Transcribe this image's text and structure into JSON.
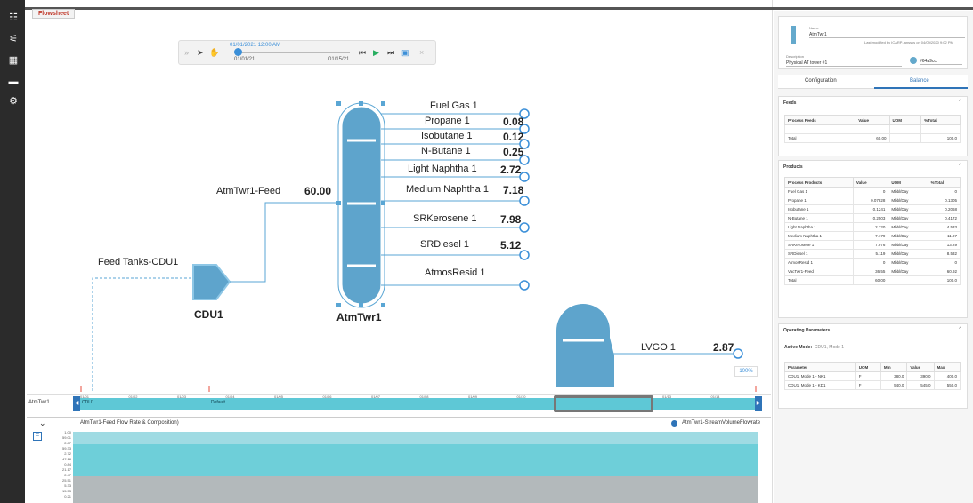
{
  "tab": "Flowsheet",
  "player": {
    "current_datetime": "01/01/2021 12:00 AM",
    "start_date": "01/01/21",
    "end_date": "01/15/21",
    "position": 0.0
  },
  "flowsheet": {
    "feed_source": "Feed Tanks-CDU1",
    "cdu_name": "CDU1",
    "tower_name": "AtmTwr1",
    "feed_stream": "AtmTwr1-Feed",
    "feed_value": "60.00",
    "products": [
      {
        "name": "Fuel Gas 1",
        "value": ""
      },
      {
        "name": "Propane 1",
        "value": "0.08"
      },
      {
        "name": "Isobutane 1",
        "value": "0.12"
      },
      {
        "name": "N-Butane 1",
        "value": "0.25"
      },
      {
        "name": "Light Naphtha 1",
        "value": "2.72"
      },
      {
        "name": "Medium Naphtha 1",
        "value": "7.18"
      },
      {
        "name": "SRKerosene 1",
        "value": "7.98"
      },
      {
        "name": "SRDiesel 1",
        "value": "5.12"
      },
      {
        "name": "AtmosResid 1",
        "value": ""
      }
    ],
    "vac_stream": "LVGO 1",
    "vac_value": "2.87",
    "zoom": "100%"
  },
  "timeline": {
    "row_label": "AtmTwr1",
    "segment_unit": "CDU1",
    "segment_mode": "Default",
    "ticks": [
      "01/01",
      "01/02",
      "01/03",
      "01/04",
      "01/05",
      "01/06",
      "01/07",
      "01/08",
      "01/09",
      "01/10",
      "01/11",
      "01/12",
      "01/13",
      "01/14"
    ]
  },
  "trend": {
    "title": "AtmTwr1-Feed Flow Rate & Composition)",
    "legend": "AtmTwr1-StreamVolumeFlowrate",
    "axis_ticks": [
      "1.00",
      "59.01",
      "2.87",
      "59.33",
      "2.72",
      "47.18",
      "0.84",
      "21.17",
      "2.47",
      "25.51",
      "5.33",
      "15.53",
      "0.21"
    ]
  },
  "panel": {
    "name_label": "Name",
    "name": "AtmTwr1",
    "modified": "Last modified by ICARP-janssys on 04/09/2020 9:02 PM",
    "desc_label": "Description",
    "description": "Physical AT tower #1",
    "color_hex": "#64a9cc",
    "tab_config": "Configuration",
    "tab_balance": "Balance",
    "feeds": {
      "title": "Feeds",
      "headers": [
        "Process Feeds",
        "Value",
        "UOM",
        "%Total"
      ],
      "rows": [
        [
          "",
          "",
          "",
          ""
        ],
        [
          "Total",
          "60.00",
          "",
          "100.0"
        ]
      ]
    },
    "products": {
      "title": "Products",
      "headers": [
        "Process Products",
        "Value",
        "UOM",
        "%Total"
      ],
      "rows": [
        [
          "Fuel Gas 1",
          "0",
          "Mbbl/Day",
          "0"
        ],
        [
          "Propane 1",
          "0.07828",
          "Mbbl/Day",
          "0.1305"
        ],
        [
          "Isobutane 1",
          "0.1241",
          "Mbbl/Day",
          "0.2068"
        ],
        [
          "N-Butane 1",
          "0.2503",
          "Mbbl/Day",
          "0.4172"
        ],
        [
          "Light Naphtha 1",
          "2.720",
          "Mbbl/Day",
          "4.533"
        ],
        [
          "Medium Naphtha 1",
          "7.179",
          "Mbbl/Day",
          "11.97"
        ],
        [
          "SRKerosene 1",
          "7.976",
          "Mbbl/Day",
          "13.29"
        ],
        [
          "SRDiesel 1",
          "5.119",
          "Mbbl/Day",
          "8.532"
        ],
        [
          "AtmosResid 1",
          "0",
          "Mbbl/Day",
          "0"
        ],
        [
          "VacTwr1-Feed",
          "36.55",
          "Mbbl/Day",
          "60.92"
        ],
        [
          "Total",
          "60.00",
          "",
          "100.0"
        ]
      ]
    },
    "operating": {
      "title": "Operating Parameters",
      "active_mode_label": "Active Mode:",
      "active_mode": "CDU1, Mode 1",
      "headers": [
        "Parameter",
        "UOM",
        "Min",
        "Value",
        "Max"
      ],
      "rows": [
        [
          "CDU1, Mode 1 - NK1",
          "F",
          "380.0",
          "390.0",
          "400.0"
        ],
        [
          "CDU1, Mode 1 - KD1",
          "F",
          "540.0",
          "545.0",
          "550.0"
        ]
      ]
    }
  }
}
